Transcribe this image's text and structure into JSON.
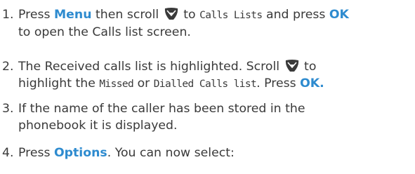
{
  "steps": [
    {
      "number": "1.",
      "prefix": "Press ",
      "key_menu": "Menu",
      "mid1": " then scroll ",
      "icon": "nav-scroll-key-icon",
      "mid2": " to ",
      "lcd_text": "Calls Lists",
      "mid3": " and press ",
      "key_ok": "OK",
      "line2": "to open the Calls list screen."
    },
    {
      "number": "2.",
      "text1": "The Received calls list is highlighted. Scroll ",
      "icon": "nav-scroll-key-icon",
      "text2": " to",
      "line2_pre": "highlight the ",
      "lcd_missed": "Missed",
      "or_text": " or ",
      "lcd_dialled": "Dialled Calls list",
      "press_text": ". Press ",
      "key_ok": "OK."
    },
    {
      "number": "3.",
      "line1": "If the name of the caller has been stored in the",
      "line2": "phonebook it is displayed."
    },
    {
      "number": "4.",
      "prefix": "Press ",
      "key_options": "Options",
      "suffix": ". You can now select:"
    }
  ],
  "colors": {
    "text": "#3a3a3a",
    "key": "#2e8bcf"
  }
}
